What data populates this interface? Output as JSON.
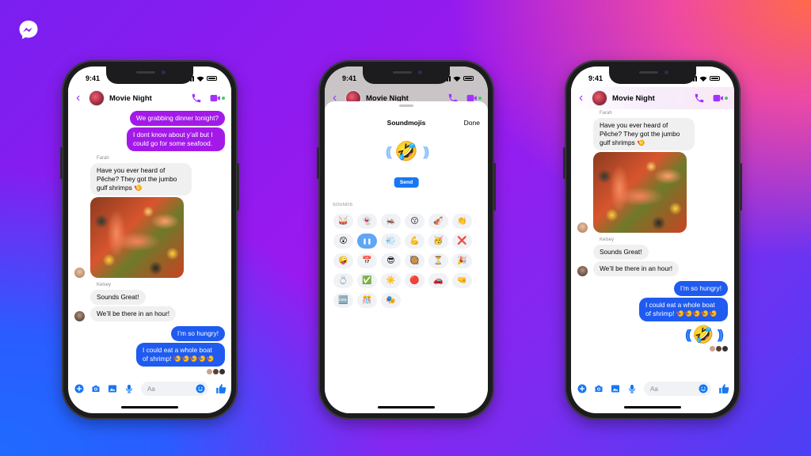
{
  "brand": {
    "logo_icon": "messenger-logo-icon"
  },
  "colors": {
    "purple_bubble": "#a31ae8",
    "blue_bubble": "#1f5bf0",
    "gray_bubble": "#f0f0f0",
    "accent_purple": "#a033ff",
    "messenger_blue": "#1877f2",
    "online_green": "#31d35c"
  },
  "phones": [
    {
      "status_time": "9:41",
      "header": {
        "title": "Movie Night"
      },
      "messages": {
        "out1": "We grabbing dinner tonight?",
        "out2": "I dont know about y’all but I could go for some seafood.",
        "farah_label": "Farah",
        "farah_msg": "Have you ever heard of Pêche? They got the jumbo gulf shrimps 🍤",
        "kelsey_label": "Kelsey",
        "kelsey_msg1": "Sounds Great!",
        "kelsey_msg2": "We’ll be there in an hour!",
        "out3": "I’m so hungry!",
        "out4": "I could eat a whole boat of shrimp! 🍤🍤🍤🍤🍤"
      },
      "composer": {
        "placeholder": "Aa"
      }
    },
    {
      "status_time": "9:41",
      "header": {
        "title": "Movie Night"
      },
      "sheet": {
        "title": "Soundmojis",
        "done_label": "Done",
        "preview_emoji": "🤣",
        "send_label": "Send",
        "section_label": "SOUNDS",
        "sounds": [
          {
            "emoji": "🥁",
            "name": "drum"
          },
          {
            "emoji": "👻",
            "name": "ghost"
          },
          {
            "emoji": "🦗",
            "name": "cricket"
          },
          {
            "emoji": "😗",
            "name": "kissing-face"
          },
          {
            "emoji": "🎻",
            "name": "violin"
          },
          {
            "emoji": "👏",
            "name": "clapping-hands"
          },
          {
            "emoji": "😲",
            "name": "astonished-face"
          },
          {
            "emoji": "❚❚",
            "name": "pause",
            "active": true
          },
          {
            "emoji": "💨",
            "name": "dashing-away"
          },
          {
            "emoji": "💪",
            "name": "flexed-biceps"
          },
          {
            "emoji": "🥳",
            "name": "partying-face"
          },
          {
            "emoji": "❌",
            "name": "cross-mark"
          },
          {
            "emoji": "🤪",
            "name": "zany-face"
          },
          {
            "emoji": "📅",
            "name": "calendar"
          },
          {
            "emoji": "😎",
            "name": "sunglasses-face"
          },
          {
            "emoji": "🥘",
            "name": "paella"
          },
          {
            "emoji": "⏳",
            "name": "hourglass"
          },
          {
            "emoji": "🎉",
            "name": "party-popper"
          },
          {
            "emoji": "💍",
            "name": "ring"
          },
          {
            "emoji": "✅",
            "name": "check-mark"
          },
          {
            "emoji": "☀️",
            "name": "sun"
          },
          {
            "emoji": "🔴",
            "name": "red-circle"
          },
          {
            "emoji": "🚗",
            "name": "car"
          },
          {
            "emoji": "🤜",
            "name": "fist-bump"
          },
          {
            "emoji": "🆒",
            "name": "cool-button"
          },
          {
            "emoji": "🎊",
            "name": "confetti"
          },
          {
            "emoji": "🎭",
            "name": "performing-arts"
          }
        ]
      }
    },
    {
      "status_time": "9:41",
      "header": {
        "title": "Movie Night"
      },
      "messages": {
        "farah_label": "Farah",
        "farah_msg": "Have you ever heard of Pêche? They got the jumbo gulf shrimps 🍤",
        "kelsey_label": "Kelsey",
        "kelsey_msg1": "Sounds Great!",
        "kelsey_msg2": "We’ll be there in an hour!",
        "out3": "I’m so hungry!",
        "out4": "I could eat a whole boat of shrimp! 🍤🍤🍤🍤🍤",
        "soundmoji": "🤣"
      },
      "composer": {
        "placeholder": "Aa"
      }
    }
  ]
}
